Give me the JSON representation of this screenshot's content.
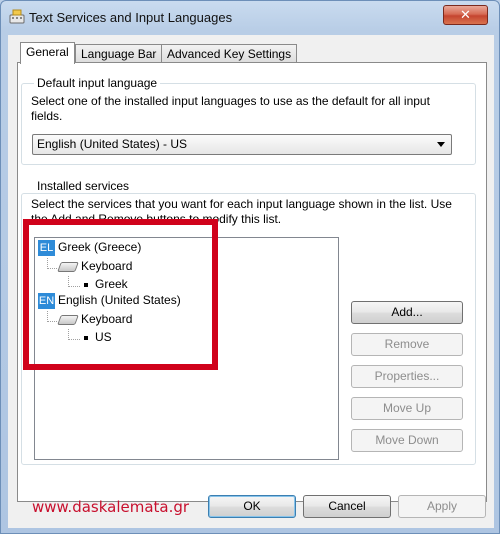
{
  "window": {
    "title": "Text Services and Input Languages",
    "close_label": "✕"
  },
  "tabs": [
    {
      "label": "General",
      "active": true
    },
    {
      "label": "Language Bar",
      "active": false
    },
    {
      "label": "Advanced Key Settings",
      "active": false
    }
  ],
  "default_input": {
    "legend": "Default input language",
    "description": "Select one of the installed input languages to use as the default for all input fields.",
    "selected": "English (United States) - US"
  },
  "installed_services": {
    "legend": "Installed services",
    "description": "Select the services that you want for each input language shown in the list. Use the Add and Remove buttons to modify this list.",
    "tree": [
      {
        "badge": "EL",
        "language": "Greek (Greece)",
        "category": "Keyboard",
        "layout": "Greek"
      },
      {
        "badge": "EN",
        "language": "English (United States)",
        "category": "Keyboard",
        "layout": "US"
      }
    ],
    "buttons": {
      "add": "Add...",
      "remove": "Remove",
      "properties": "Properties...",
      "move_up": "Move Up",
      "move_down": "Move Down"
    }
  },
  "footer": {
    "watermark": "www.daskalemata.gr",
    "ok": "OK",
    "cancel": "Cancel",
    "apply": "Apply"
  },
  "colors": {
    "highlight": "#d0021b",
    "lang_badge": "#2e8bd8",
    "watermark": "#c8102e"
  }
}
